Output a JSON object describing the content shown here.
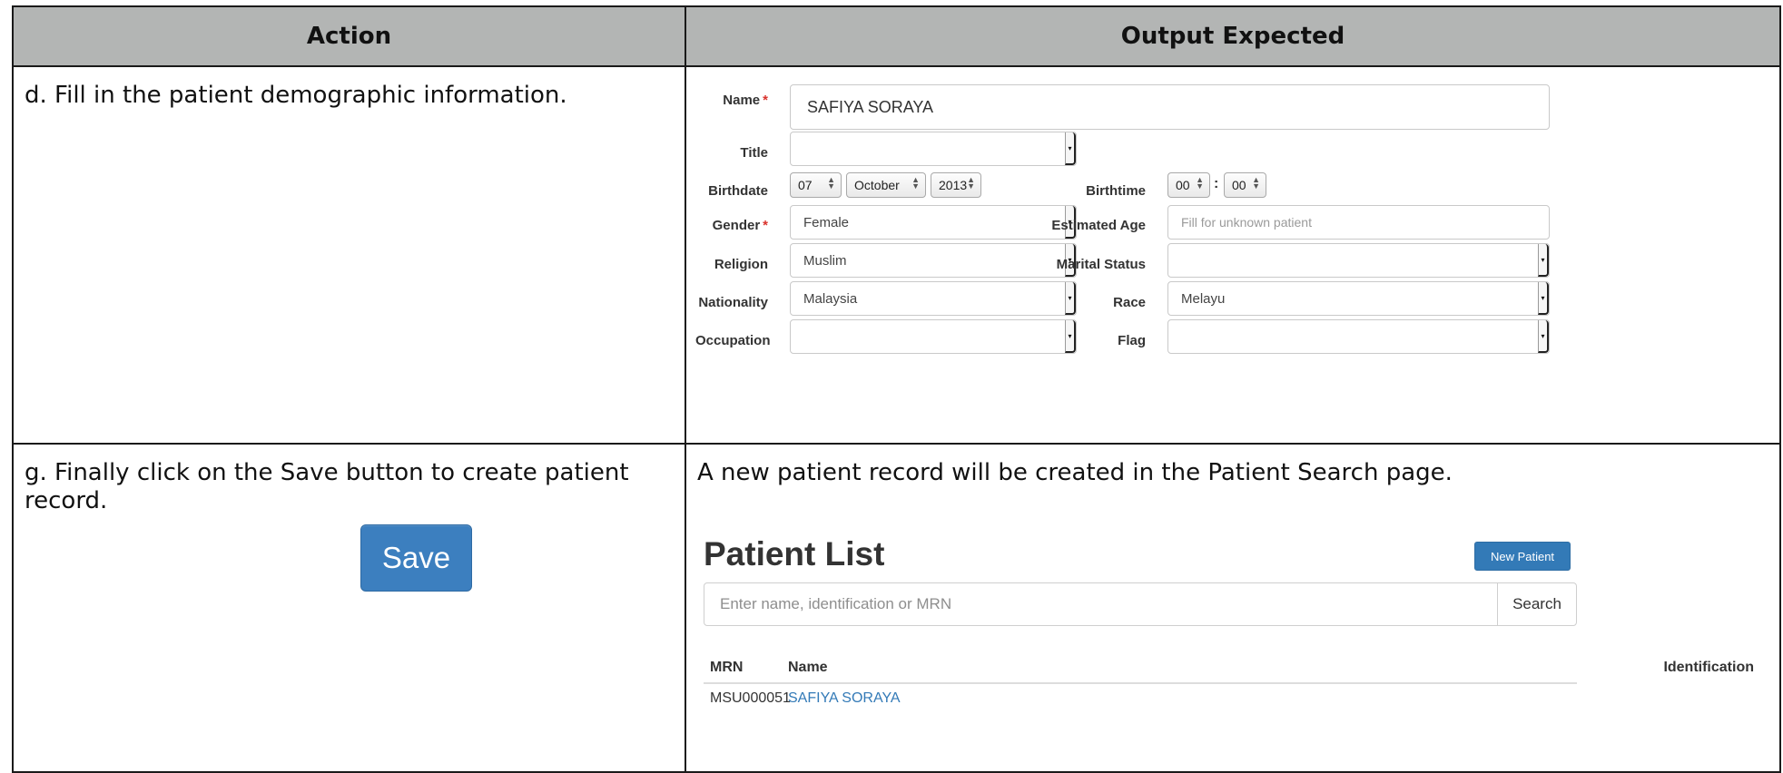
{
  "table": {
    "headers": {
      "action": "Action",
      "output": "Output Expected"
    }
  },
  "step_d": {
    "text": "d. Fill in the patient demographic information."
  },
  "form": {
    "name_label": "Name",
    "name_value": "SAFIYA SORAYA",
    "title_label": "Title",
    "title_value": "",
    "birthdate_label": "Birthdate",
    "birth_day": "07",
    "birth_month": "October",
    "birth_year": "2013",
    "birthtime_label": "Birthtime",
    "birth_hour": "00",
    "birth_minute": "00",
    "time_sep": ":",
    "gender_label": "Gender",
    "gender_value": "Female",
    "estimated_age_label": "Estimated Age",
    "estimated_age_placeholder": "Fill for unknown patient",
    "religion_label": "Religion",
    "religion_value": "Muslim",
    "marital_label": "Marital Status",
    "marital_value": "",
    "nationality_label": "Nationality",
    "nationality_value": "Malaysia",
    "race_label": "Race",
    "race_value": "Melayu",
    "occupation_label": "Occupation",
    "occupation_value": "",
    "flag_label": "Flag",
    "flag_value": "",
    "required_marker": "*"
  },
  "step_g": {
    "text": "g. Finally click on the Save button to create patient record.",
    "save_label": "Save"
  },
  "output_g": {
    "text": "A new patient record will be created in the Patient Search page."
  },
  "patient_list": {
    "title": "Patient List",
    "new_patient_label": "New Patient",
    "search_placeholder": "Enter name, identification or MRN",
    "search_label": "Search",
    "columns": {
      "mrn": "MRN",
      "name": "Name",
      "identification": "Identification"
    },
    "rows": [
      {
        "mrn": "MSU000051",
        "name": "SAFIYA SORAYA",
        "identification": ""
      }
    ]
  },
  "colors": {
    "header_bg": "#b3b5b4",
    "primary_button": "#337ab7",
    "link": "#337ab7",
    "required": "#d9322c"
  }
}
